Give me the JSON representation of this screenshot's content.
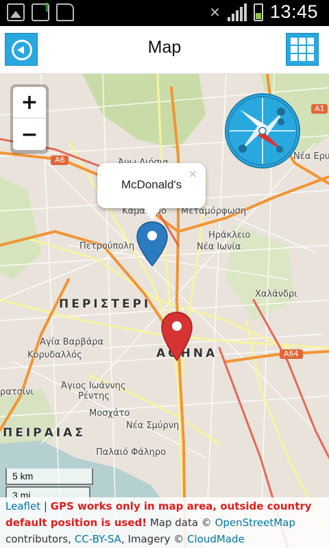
{
  "status_bar": {
    "time": "13:45"
  },
  "app_bar": {
    "title": "Map"
  },
  "map": {
    "labels": {
      "athina": "ΑΘΗΝΑ",
      "peristeri": "ΠΕΡΙΣΤΕΡΙ",
      "peiraias": "ΠΕΙΡΑΙΑΣ",
      "petroupoli": "Πετρούπολη",
      "kamatero": "Καματερό",
      "metamorfosi": "Μεταμόρφωση",
      "irakleio": "Ηράκλειο",
      "nea_ionia": "Νέα Ιωνία",
      "chalandri": "Χαλάνδρι",
      "agia_varvara": "Αγία Βαρβάρα",
      "korydallos": "Κορυδαλλός",
      "agios_ioannis": "Άγιος Ιωάννης",
      "rentis": "Ρέντης",
      "moschato": "Μοσχάτο",
      "nea_smyrni": "Νέα Σμύρνη",
      "palaio_faliro": "Παλαιό Φάληρο",
      "keratsini": "ρατσίνι",
      "ano_liosia": "Άνω Λιόσια",
      "nea_erythraia": "Νέα Ερυθρ",
      "a6": "A6",
      "a1": "A1",
      "a64": "A64"
    },
    "popup": {
      "text": "McDonald's",
      "close": "×"
    },
    "zoom": {
      "in": "+",
      "out": "−"
    },
    "scale": {
      "km": "5 km",
      "mi": "3 mi"
    }
  },
  "attribution": {
    "leaflet": "Leaflet",
    "sep": " | ",
    "warning": "GPS works only in map area, outside country default position is used!",
    "map_data": " Map data © ",
    "osm": "OpenStreetMap",
    "contributors": " contributors, ",
    "license": "CC-BY-SA",
    "imagery": ", Imagery © ",
    "cloudmade": "CloudMade"
  },
  "colors": {
    "accent": "#29a8e0",
    "pin_blue": "#2c7bc0",
    "pin_red": "#d63333",
    "warning": "#e21b1b",
    "link": "#0078a8"
  }
}
